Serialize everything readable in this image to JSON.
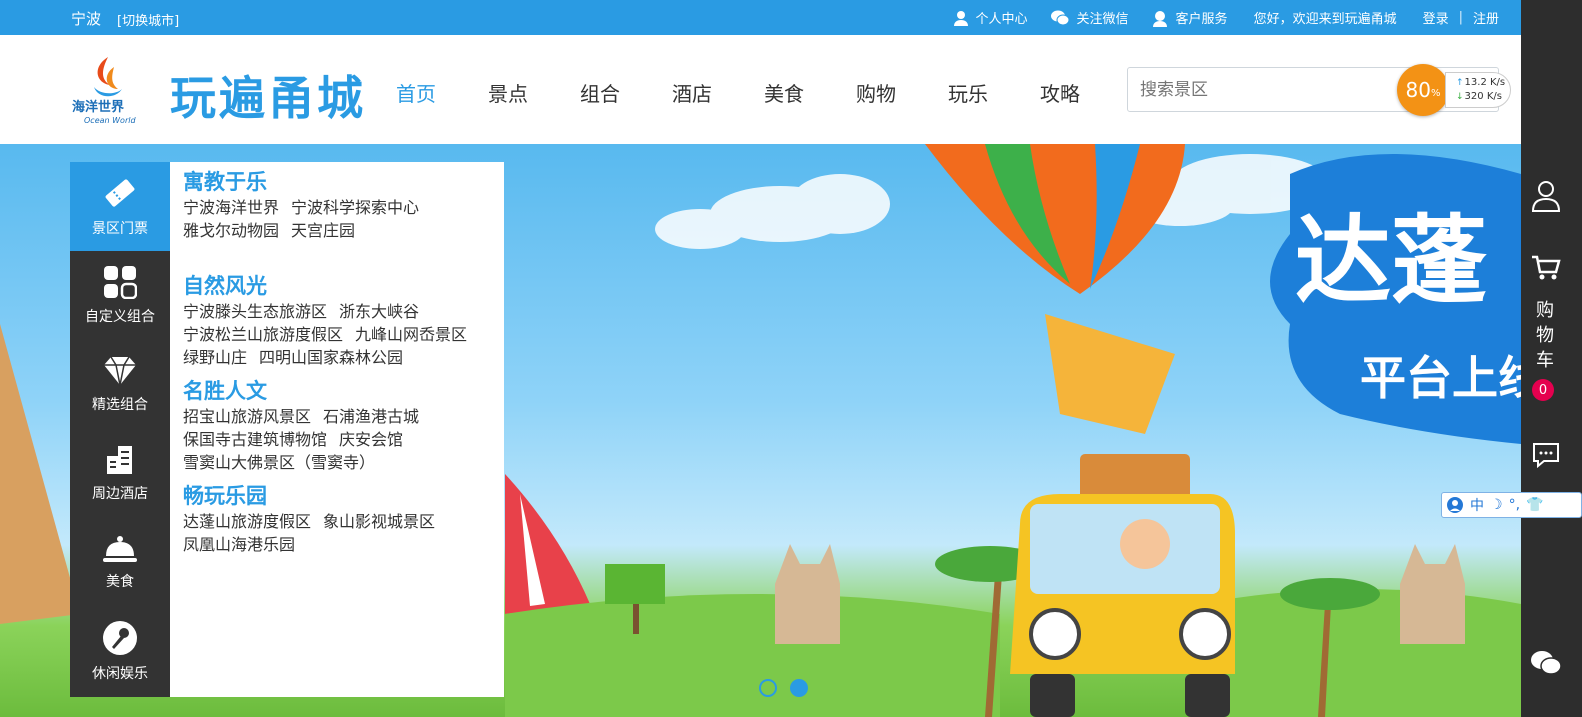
{
  "topbar": {
    "city": "宁波",
    "switch_city": "[切换城市]",
    "links": [
      "个人中心",
      "关注微信",
      "客户服务"
    ],
    "welcome": "您好，欢迎来到玩遍甬城",
    "login": "登录",
    "separator": "|",
    "register": "注册"
  },
  "header": {
    "logo_text": "海洋世界",
    "logo_sub": "Ocean World",
    "brand": "玩遍甬城",
    "nav": [
      "首页",
      "景点",
      "组合",
      "酒店",
      "美食",
      "购物",
      "玩乐",
      "攻略"
    ],
    "active_nav": "首页",
    "search_placeholder": "搜索景区"
  },
  "speed_widget": {
    "percent": "80",
    "percent_unit": "%",
    "upload": "13.2 K/s",
    "download": "320 K/s"
  },
  "category_menu": [
    {
      "label": "景区门票",
      "icon": "ticket-icon",
      "active": true
    },
    {
      "label": "自定义组合",
      "icon": "grid-icon",
      "active": false
    },
    {
      "label": "精选组合",
      "icon": "diamond-icon",
      "active": false
    },
    {
      "label": "周边酒店",
      "icon": "building-icon",
      "active": false
    },
    {
      "label": "美食",
      "icon": "cloche-icon",
      "active": false
    },
    {
      "label": "休闲娱乐",
      "icon": "microphone-icon",
      "active": false
    }
  ],
  "subpanel": [
    {
      "title": "寓教于乐",
      "rows": [
        [
          "宁波海洋世界",
          "宁波科学探索中心"
        ],
        [
          "雅戈尔动物园",
          "天宫庄园"
        ]
      ]
    },
    {
      "title": "自然风光",
      "rows": [
        [
          "宁波滕头生态旅游区",
          "浙东大峡谷"
        ],
        [
          "宁波松兰山旅游度假区",
          "九峰山网岙景区"
        ],
        [
          "绿野山庄",
          "四明山国家森林公园"
        ]
      ]
    },
    {
      "title": "名胜人文",
      "rows": [
        [
          "招宝山旅游风景区",
          "石浦渔港古城"
        ],
        [
          "保国寺古建筑博物馆",
          "庆安会馆"
        ],
        [
          "雪窦山大佛景区（雪窦寺）"
        ]
      ]
    },
    {
      "title": "畅玩乐园",
      "rows": [
        [
          "达蓬山旅游度假区",
          "象山影视城景区"
        ],
        [
          "凤凰山海港乐园"
        ]
      ]
    }
  ],
  "banner": {
    "headline": "达蓬",
    "subline": "平台上线",
    "slide_count": 2,
    "active_slide": 2
  },
  "sidebar": {
    "cart_label": "购物车",
    "cart_count": "0"
  },
  "ime_toolbar": {
    "mode": "中"
  },
  "colors": {
    "primary": "#2a9be3",
    "menu_dark": "#333333",
    "sidebar": "#2d2d2d",
    "badge": "#e5004f",
    "speed_ball": "#f39215"
  }
}
